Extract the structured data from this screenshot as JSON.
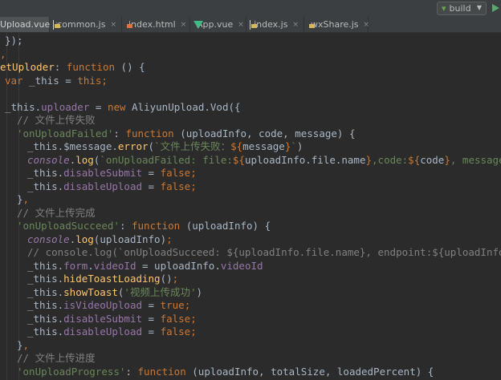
{
  "toolbar": {
    "run_config": "build",
    "run_icon": "play-icon",
    "config_icon": "vue-config-icon"
  },
  "tabs": [
    {
      "label": "Upload.vue",
      "icon": "vue-file-icon",
      "active": true
    },
    {
      "label": "common.js",
      "icon": "js-file-icon",
      "active": false
    },
    {
      "label": "index.html",
      "icon": "html-file-icon",
      "active": false
    },
    {
      "label": "App.vue",
      "icon": "vue-file-icon",
      "active": false
    },
    {
      "label": "index.js",
      "icon": "js-file-icon",
      "active": false
    },
    {
      "label": "wxShare.js",
      "icon": "js-file-icon",
      "active": false
    }
  ],
  "code": [
    {
      "x": 6,
      "tokens": [
        [
          "pl",
          "});"
        ],
        [
          "kw",
          ""
        ]
      ]
    },
    {
      "x": 0,
      "tokens": [
        [
          "kw",
          ","
        ]
      ]
    },
    {
      "x": 0,
      "tokens": [
        [
          "fn",
          "etUploder"
        ],
        [
          "pl",
          ": "
        ],
        [
          "kw",
          "function"
        ],
        [
          "pl",
          " () {"
        ]
      ]
    },
    {
      "x": 6,
      "tokens": [
        [
          "kw",
          "var"
        ],
        [
          "pl",
          " _this = "
        ],
        [
          "kw",
          "this"
        ],
        [
          "kw",
          ";"
        ]
      ]
    },
    {
      "x": 0,
      "tokens": []
    },
    {
      "x": 6,
      "tokens": [
        [
          "pl",
          "_this."
        ],
        [
          "prop",
          "uploader"
        ],
        [
          "pl",
          " = "
        ],
        [
          "kw",
          "new"
        ],
        [
          "pl",
          " AliyunUpload.Vod({"
        ]
      ]
    },
    {
      "x": 21,
      "tokens": [
        [
          "cm",
          "// 文件上传失败"
        ]
      ]
    },
    {
      "x": 21,
      "tokens": [
        [
          "str",
          "'onUploadFailed'"
        ],
        [
          "pl",
          ": "
        ],
        [
          "kw",
          "function"
        ],
        [
          "pl",
          " (uploadInfo, code, message) {"
        ]
      ]
    },
    {
      "x": 34,
      "tokens": [
        [
          "pl",
          "_this.$message."
        ],
        [
          "fn",
          "error"
        ],
        [
          "pl",
          "("
        ],
        [
          "str",
          "`文件上传失败："
        ],
        [
          "kw",
          "${"
        ],
        [
          "pl",
          "message"
        ],
        [
          "kw",
          "}"
        ],
        [
          "str",
          "`"
        ],
        [
          "pl",
          ")"
        ]
      ]
    },
    {
      "x": 34,
      "tokens": [
        [
          "con",
          "console"
        ],
        [
          "pl",
          "."
        ],
        [
          "fn",
          "log"
        ],
        [
          "pl",
          "("
        ],
        [
          "str",
          "`onUploadFailed: file:"
        ],
        [
          "kw",
          "${"
        ],
        [
          "pl",
          "uploadInfo.file.name"
        ],
        [
          "kw",
          "}"
        ],
        [
          "str",
          ",code:"
        ],
        [
          "kw",
          "${"
        ],
        [
          "pl",
          "code"
        ],
        [
          "kw",
          "}"
        ],
        [
          "str",
          ", message:"
        ],
        [
          "kw",
          "${"
        ]
      ]
    },
    {
      "x": 34,
      "tokens": [
        [
          "pl",
          "_this."
        ],
        [
          "prop",
          "disableSubmit"
        ],
        [
          "pl",
          " = "
        ],
        [
          "kw",
          "false"
        ],
        [
          "kw",
          ";"
        ]
      ]
    },
    {
      "x": 34,
      "tokens": [
        [
          "pl",
          "_this."
        ],
        [
          "prop",
          "disableUpload"
        ],
        [
          "pl",
          " = "
        ],
        [
          "kw",
          "false"
        ],
        [
          "kw",
          ";"
        ]
      ]
    },
    {
      "x": 21,
      "tokens": [
        [
          "pl",
          "}"
        ],
        [
          "kw",
          ","
        ]
      ]
    },
    {
      "x": 21,
      "tokens": [
        [
          "cm",
          "// 文件上传完成"
        ]
      ]
    },
    {
      "x": 21,
      "tokens": [
        [
          "str",
          "'onUploadSucceed'"
        ],
        [
          "pl",
          ": "
        ],
        [
          "kw",
          "function"
        ],
        [
          "pl",
          " (uploadInfo) {"
        ]
      ]
    },
    {
      "x": 34,
      "tokens": [
        [
          "con",
          "console"
        ],
        [
          "pl",
          "."
        ],
        [
          "fn",
          "log"
        ],
        [
          "pl",
          "(uploadInfo)"
        ],
        [
          "kw",
          ";"
        ]
      ]
    },
    {
      "x": 34,
      "tokens": [
        [
          "cm",
          "// console.log(`onUploadSucceed: ${uploadInfo.file.name}, endpoint:${uploadInfo.en"
        ]
      ]
    },
    {
      "x": 34,
      "tokens": [
        [
          "pl",
          "_this."
        ],
        [
          "prop",
          "form"
        ],
        [
          "pl",
          "."
        ],
        [
          "prop",
          "videoId"
        ],
        [
          "pl",
          " = uploadInfo."
        ],
        [
          "prop",
          "videoId"
        ]
      ]
    },
    {
      "x": 34,
      "tokens": [
        [
          "pl",
          "_this."
        ],
        [
          "fn",
          "hideToastLoading"
        ],
        [
          "pl",
          "()"
        ],
        [
          "kw",
          ";"
        ]
      ]
    },
    {
      "x": 34,
      "tokens": [
        [
          "pl",
          "_this."
        ],
        [
          "fn",
          "showToast"
        ],
        [
          "pl",
          "("
        ],
        [
          "str",
          "'视频上传成功'"
        ],
        [
          "pl",
          ")"
        ]
      ]
    },
    {
      "x": 34,
      "tokens": [
        [
          "pl",
          "_this."
        ],
        [
          "prop",
          "isVideoUpload"
        ],
        [
          "pl",
          " = "
        ],
        [
          "kw",
          "true"
        ],
        [
          "kw",
          ";"
        ]
      ]
    },
    {
      "x": 34,
      "tokens": [
        [
          "pl",
          "_this."
        ],
        [
          "prop",
          "disableSubmit"
        ],
        [
          "pl",
          " = "
        ],
        [
          "kw",
          "false"
        ],
        [
          "kw",
          ";"
        ]
      ]
    },
    {
      "x": 34,
      "tokens": [
        [
          "pl",
          "_this."
        ],
        [
          "prop",
          "disableUpload"
        ],
        [
          "pl",
          " = "
        ],
        [
          "kw",
          "false"
        ],
        [
          "kw",
          ";"
        ]
      ]
    },
    {
      "x": 21,
      "tokens": [
        [
          "pl",
          "}"
        ],
        [
          "kw",
          ","
        ]
      ]
    },
    {
      "x": 21,
      "tokens": [
        [
          "cm",
          "// 文件上传进度"
        ]
      ]
    },
    {
      "x": 21,
      "tokens": [
        [
          "str",
          "'onUploadProgress'"
        ],
        [
          "pl",
          ": "
        ],
        [
          "kw",
          "function"
        ],
        [
          "pl",
          " (uploadInfo, totalSize, loadedPercent) {"
        ]
      ]
    }
  ]
}
